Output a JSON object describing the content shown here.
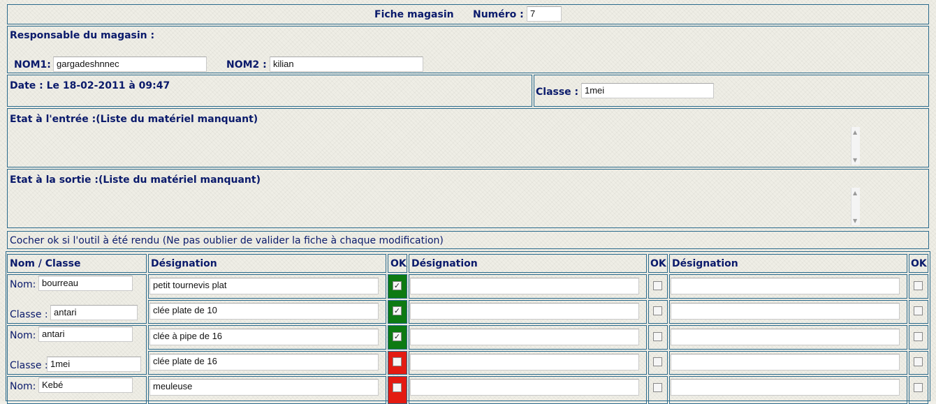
{
  "header": {
    "title": "Fiche magasin",
    "numero_label": "Numéro :",
    "numero_value": "7"
  },
  "responsable": {
    "label": "Responsable du magasin :",
    "nom1_label": "NOM1:",
    "nom1_value": "gargadeshnnec",
    "nom2_label": "NOM2 :",
    "nom2_value": "kilian"
  },
  "date": {
    "text": "Date : Le 18-02-2011 à 09:47"
  },
  "classe": {
    "label": "Classe :",
    "value": "1mei"
  },
  "etat_entree": {
    "label": "Etat à l'entrée :(Liste du matériel manquant)"
  },
  "etat_sortie": {
    "label": "Etat à la sortie :(Liste du matériel manquant)"
  },
  "instruction": "Cocher ok si l'outil à été rendu (Ne pas oublier de valider la fiche à chaque modification)",
  "table": {
    "headers": [
      "Nom / Classe",
      "Désignation",
      "OK",
      "Désignation",
      "OK",
      "Désignation",
      "OK"
    ],
    "nom_label": "Nom:",
    "classe_label": "Classe :",
    "students": [
      {
        "nom": "bourreau",
        "classe": "antari"
      },
      {
        "nom": "antari",
        "classe": "1mei"
      },
      {
        "nom": "Kebé"
      }
    ],
    "rows": [
      {
        "designation": "petit tournevis plat",
        "ok": true,
        "status_color": "#0d7a12"
      },
      {
        "designation": "clée plate de 10",
        "ok": true,
        "status_color": "#0d7a12"
      },
      {
        "designation": "clée à pipe de 16",
        "ok": true,
        "status_color": "#0d7a12"
      },
      {
        "designation": "clée plate de 16",
        "ok": false,
        "status_color": "#e31b12"
      },
      {
        "designation": "meuleuse",
        "ok": false,
        "status_color": "#e31b12"
      }
    ]
  }
}
